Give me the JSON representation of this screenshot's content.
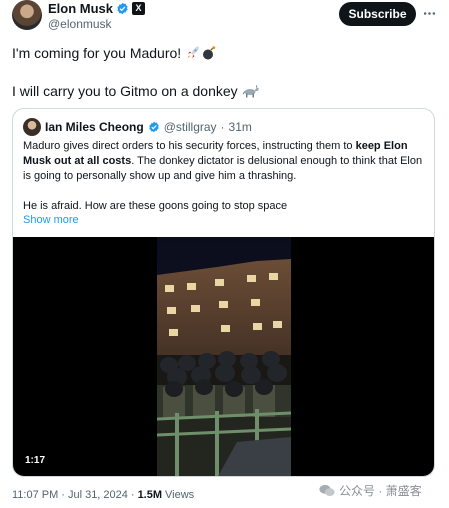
{
  "author": {
    "name": "Elon Musk",
    "handle": "@elonmusk",
    "verified_color": "#1d9bf0",
    "affiliate_badge": "X"
  },
  "subscribe_label": "Subscribe",
  "tweet": {
    "line1_text": "I'm coming for you Maduro! ",
    "line1_emojis": [
      "rocket-emoji",
      "bomb-emoji"
    ],
    "line2_text": "I will carry you to Gitmo on a donkey ",
    "line2_emojis": [
      "donkey-emoji"
    ]
  },
  "quote": {
    "name": "Ian Miles Cheong",
    "handle": "@stillgray",
    "separator": "·",
    "time": "31m",
    "body_part1": "Maduro gives direct orders to his security forces, instructing them to ",
    "body_bold": "keep Elon Musk out at all costs",
    "body_part2": ". The donkey dictator is delusional enough to think that Elon is going to personally show up and give him a thrashing.",
    "body_para2": "He is afraid. How are these goons going to stop space",
    "show_more": "Show more",
    "video_duration": "1:17"
  },
  "footer": {
    "time": "11:07 PM",
    "separator": "·",
    "date": "Jul 31, 2024",
    "separator2": "·",
    "views_count": "1.5M",
    "views_label": "Views"
  },
  "watermark": {
    "text": "公众号 · 萧盛客"
  }
}
